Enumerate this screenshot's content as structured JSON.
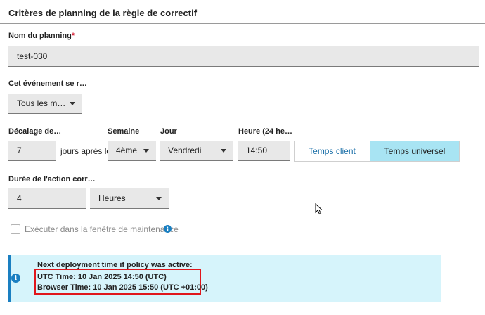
{
  "section": {
    "title": "Critères de planning de la règle de correctif"
  },
  "schedule_name": {
    "label": "Nom du planning",
    "required_mark": "*",
    "value": "test-030"
  },
  "recurrence": {
    "label": "Cet événement se r…",
    "value": "Tous les m…"
  },
  "offset": {
    "label": "Décalage de…",
    "value": "7",
    "suffix": "jours après le",
    "week": {
      "label": "Semaine",
      "value": "4ème"
    },
    "day": {
      "label": "Jour",
      "value": "Vendredi"
    },
    "hour": {
      "label": "Heure (24 he…",
      "value": "14:50"
    },
    "time_mode": {
      "client_label": "Temps client",
      "universal_label": "Temps universel",
      "selected": "universal"
    }
  },
  "duration": {
    "label": "Durée de l'action corr…",
    "value": "4",
    "unit": "Heures"
  },
  "maintenance": {
    "label": "Exécuter dans la fenêtre de maintenance",
    "checked": false,
    "info_icon": "info-circle-icon"
  },
  "deployment_info": {
    "heading": "Next deployment time if policy was active:",
    "utc_line": "UTC Time: 10 Jan 2025 14:50 (UTC)",
    "browser_line": "Browser Time: 10 Jan 2025 15:50 (UTC +01:00)",
    "icon": "info-circle-icon"
  },
  "colors": {
    "accent": "#1a7fc1",
    "selected_toggle": "#a8e4f3",
    "info_panel_bg": "#d6f4fb",
    "highlight_border": "#e0161b",
    "required": "#d0021b"
  }
}
